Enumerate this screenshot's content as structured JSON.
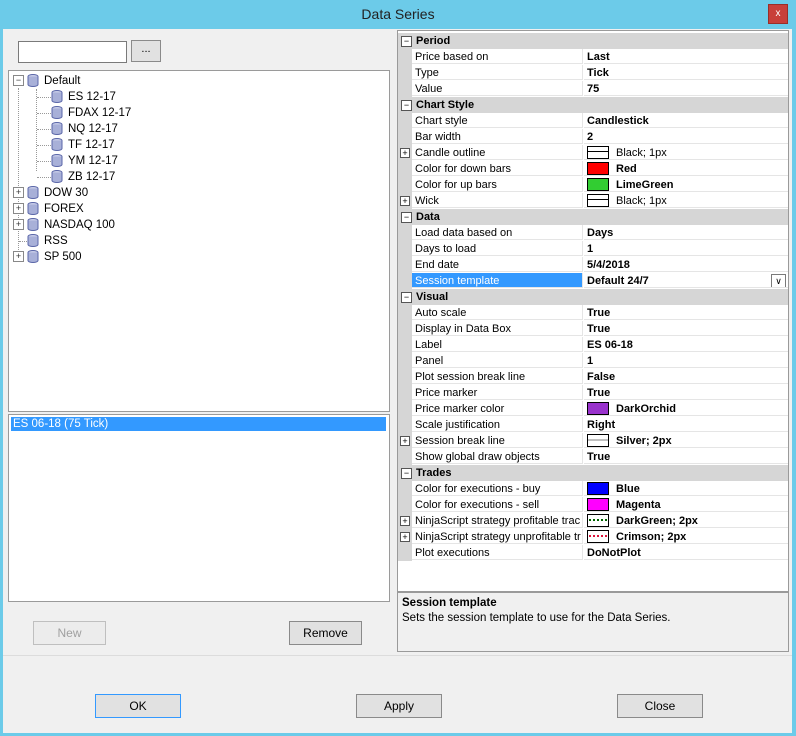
{
  "window": {
    "title": "Data Series",
    "close_label": "x"
  },
  "search": {
    "value": "",
    "ellipsis_label": "..."
  },
  "tree": {
    "root": {
      "label": "Default",
      "children": [
        "ES 12-17",
        "FDAX 12-17",
        "NQ 12-17",
        "TF 12-17",
        "YM 12-17",
        "ZB 12-17"
      ]
    },
    "groups": [
      "DOW 30",
      "FOREX",
      "NASDAQ 100",
      "RSS",
      "SP 500"
    ]
  },
  "series_list": {
    "items": [
      "ES 06-18 (75 Tick)"
    ]
  },
  "buttons": {
    "new": "New",
    "remove": "Remove",
    "ok": "OK",
    "apply": "Apply",
    "close": "Close"
  },
  "properties": {
    "period": {
      "category": "Period",
      "price_based_on": [
        "Price based on",
        "Last"
      ],
      "type": [
        "Type",
        "Tick"
      ],
      "value": [
        "Value",
        "75"
      ]
    },
    "chart_style": {
      "category": "Chart Style",
      "chart_style": [
        "Chart style",
        "Candlestick"
      ],
      "bar_width": [
        "Bar width",
        "2"
      ],
      "candle_outline": [
        "Candle outline",
        "Black; 1px"
      ],
      "down_bars": [
        "Color for down bars",
        "Red"
      ],
      "up_bars": [
        "Color for up bars",
        "LimeGreen"
      ],
      "wick": [
        "Wick",
        "Black; 1px"
      ]
    },
    "data": {
      "category": "Data",
      "load_based_on": [
        "Load data based on",
        "Days"
      ],
      "days_to_load": [
        "Days to load",
        "1"
      ],
      "end_date": [
        "End date",
        "5/4/2018"
      ],
      "session_template": [
        "Session template",
        "Default 24/7"
      ]
    },
    "visual": {
      "category": "Visual",
      "auto_scale": [
        "Auto scale",
        "True"
      ],
      "display_data_box": [
        "Display in Data Box",
        "True"
      ],
      "label": [
        "Label",
        "ES 06-18"
      ],
      "panel": [
        "Panel",
        "1"
      ],
      "plot_session_break": [
        "Plot session break line",
        "False"
      ],
      "price_marker": [
        "Price marker",
        "True"
      ],
      "price_marker_color": [
        "Price marker color",
        "DarkOrchid"
      ],
      "scale_justification": [
        "Scale justification",
        "Right"
      ],
      "session_break_line": [
        "Session break line",
        "Silver; 2px"
      ],
      "global_draw_objects": [
        "Show global draw objects",
        "True"
      ]
    },
    "trades": {
      "category": "Trades",
      "exec_buy": [
        "Color for executions - buy",
        "Blue"
      ],
      "exec_sell": [
        "Color for executions - sell",
        "Magenta"
      ],
      "strategy_profitable": [
        "NinjaScript strategy profitable trac",
        "DarkGreen; 2px"
      ],
      "strategy_unprofitable": [
        "NinjaScript strategy unprofitable tr",
        "Crimson; 2px"
      ],
      "plot_executions": [
        "Plot executions",
        "DoNotPlot"
      ]
    }
  },
  "description": {
    "title": "Session template",
    "text": "Sets the session template to use for the Data Series."
  },
  "colors": {
    "titlebar": "#6ccbe9",
    "selection": "#3399ff",
    "red": "#ff0000",
    "limegreen": "#32cd32",
    "darkorchid": "#9932cc",
    "blue": "#0000ff",
    "magenta": "#ff00ff",
    "darkgreen": "#006400",
    "crimson": "#dc143c",
    "silver": "#c0c0c0"
  }
}
